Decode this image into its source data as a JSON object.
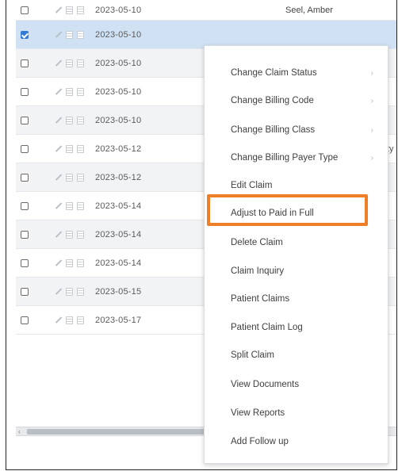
{
  "rows": [
    {
      "date": "2023-05-10",
      "name": "Seel, Amber",
      "checked": false,
      "variant": "first"
    },
    {
      "date": "2023-05-10",
      "name": "",
      "checked": true,
      "variant": "selected"
    },
    {
      "date": "2023-05-10",
      "name": "",
      "checked": false,
      "variant": "alt"
    },
    {
      "date": "2023-05-10",
      "name": "",
      "checked": false,
      "variant": ""
    },
    {
      "date": "2023-05-10",
      "name": "",
      "checked": false,
      "variant": "alt"
    },
    {
      "date": "2023-05-12",
      "name": "",
      "checked": false,
      "variant": ""
    },
    {
      "date": "2023-05-12",
      "name": "",
      "checked": false,
      "variant": "alt"
    },
    {
      "date": "2023-05-14",
      "name": "",
      "checked": false,
      "variant": ""
    },
    {
      "date": "2023-05-14",
      "name": "",
      "checked": false,
      "variant": "alt"
    },
    {
      "date": "2023-05-14",
      "name": "",
      "checked": false,
      "variant": ""
    },
    {
      "date": "2023-05-15",
      "name": "",
      "checked": false,
      "variant": "alt"
    },
    {
      "date": "2023-05-17",
      "name": "",
      "checked": false,
      "variant": ""
    }
  ],
  "row_fragment": "ty",
  "context_menu": {
    "items": [
      {
        "label": "Change Claim Status",
        "submenu": true
      },
      {
        "label": "Change Billing Code",
        "submenu": true
      },
      {
        "label": "Change Billing Class",
        "submenu": true
      },
      {
        "label": "Change Billing Payer Type",
        "submenu": true
      },
      {
        "label": "Edit Claim",
        "submenu": false
      },
      {
        "label": "Adjust to Paid in Full",
        "submenu": false,
        "highlighted": true
      },
      {
        "label": "Delete Claim",
        "submenu": false
      },
      {
        "label": "Claim Inquiry",
        "submenu": false
      },
      {
        "label": "Patient Claims",
        "submenu": false
      },
      {
        "label": "Patient Claim Log",
        "submenu": false
      },
      {
        "label": "Split Claim",
        "submenu": false
      },
      {
        "label": "View Documents",
        "submenu": false
      },
      {
        "label": "View Reports",
        "submenu": false
      },
      {
        "label": "Add Follow up",
        "submenu": false
      }
    ],
    "submenu_caret": "›"
  },
  "colors": {
    "highlight": "#ef7f26",
    "selected_row": "#cfe1f3",
    "checkbox_checked": "#2f7bd6"
  },
  "icons": [
    "edit-icon",
    "document-icon",
    "list-icon",
    "scroll-left-arrow-icon"
  ],
  "scrollbar": {
    "left_arrow": "‹"
  }
}
